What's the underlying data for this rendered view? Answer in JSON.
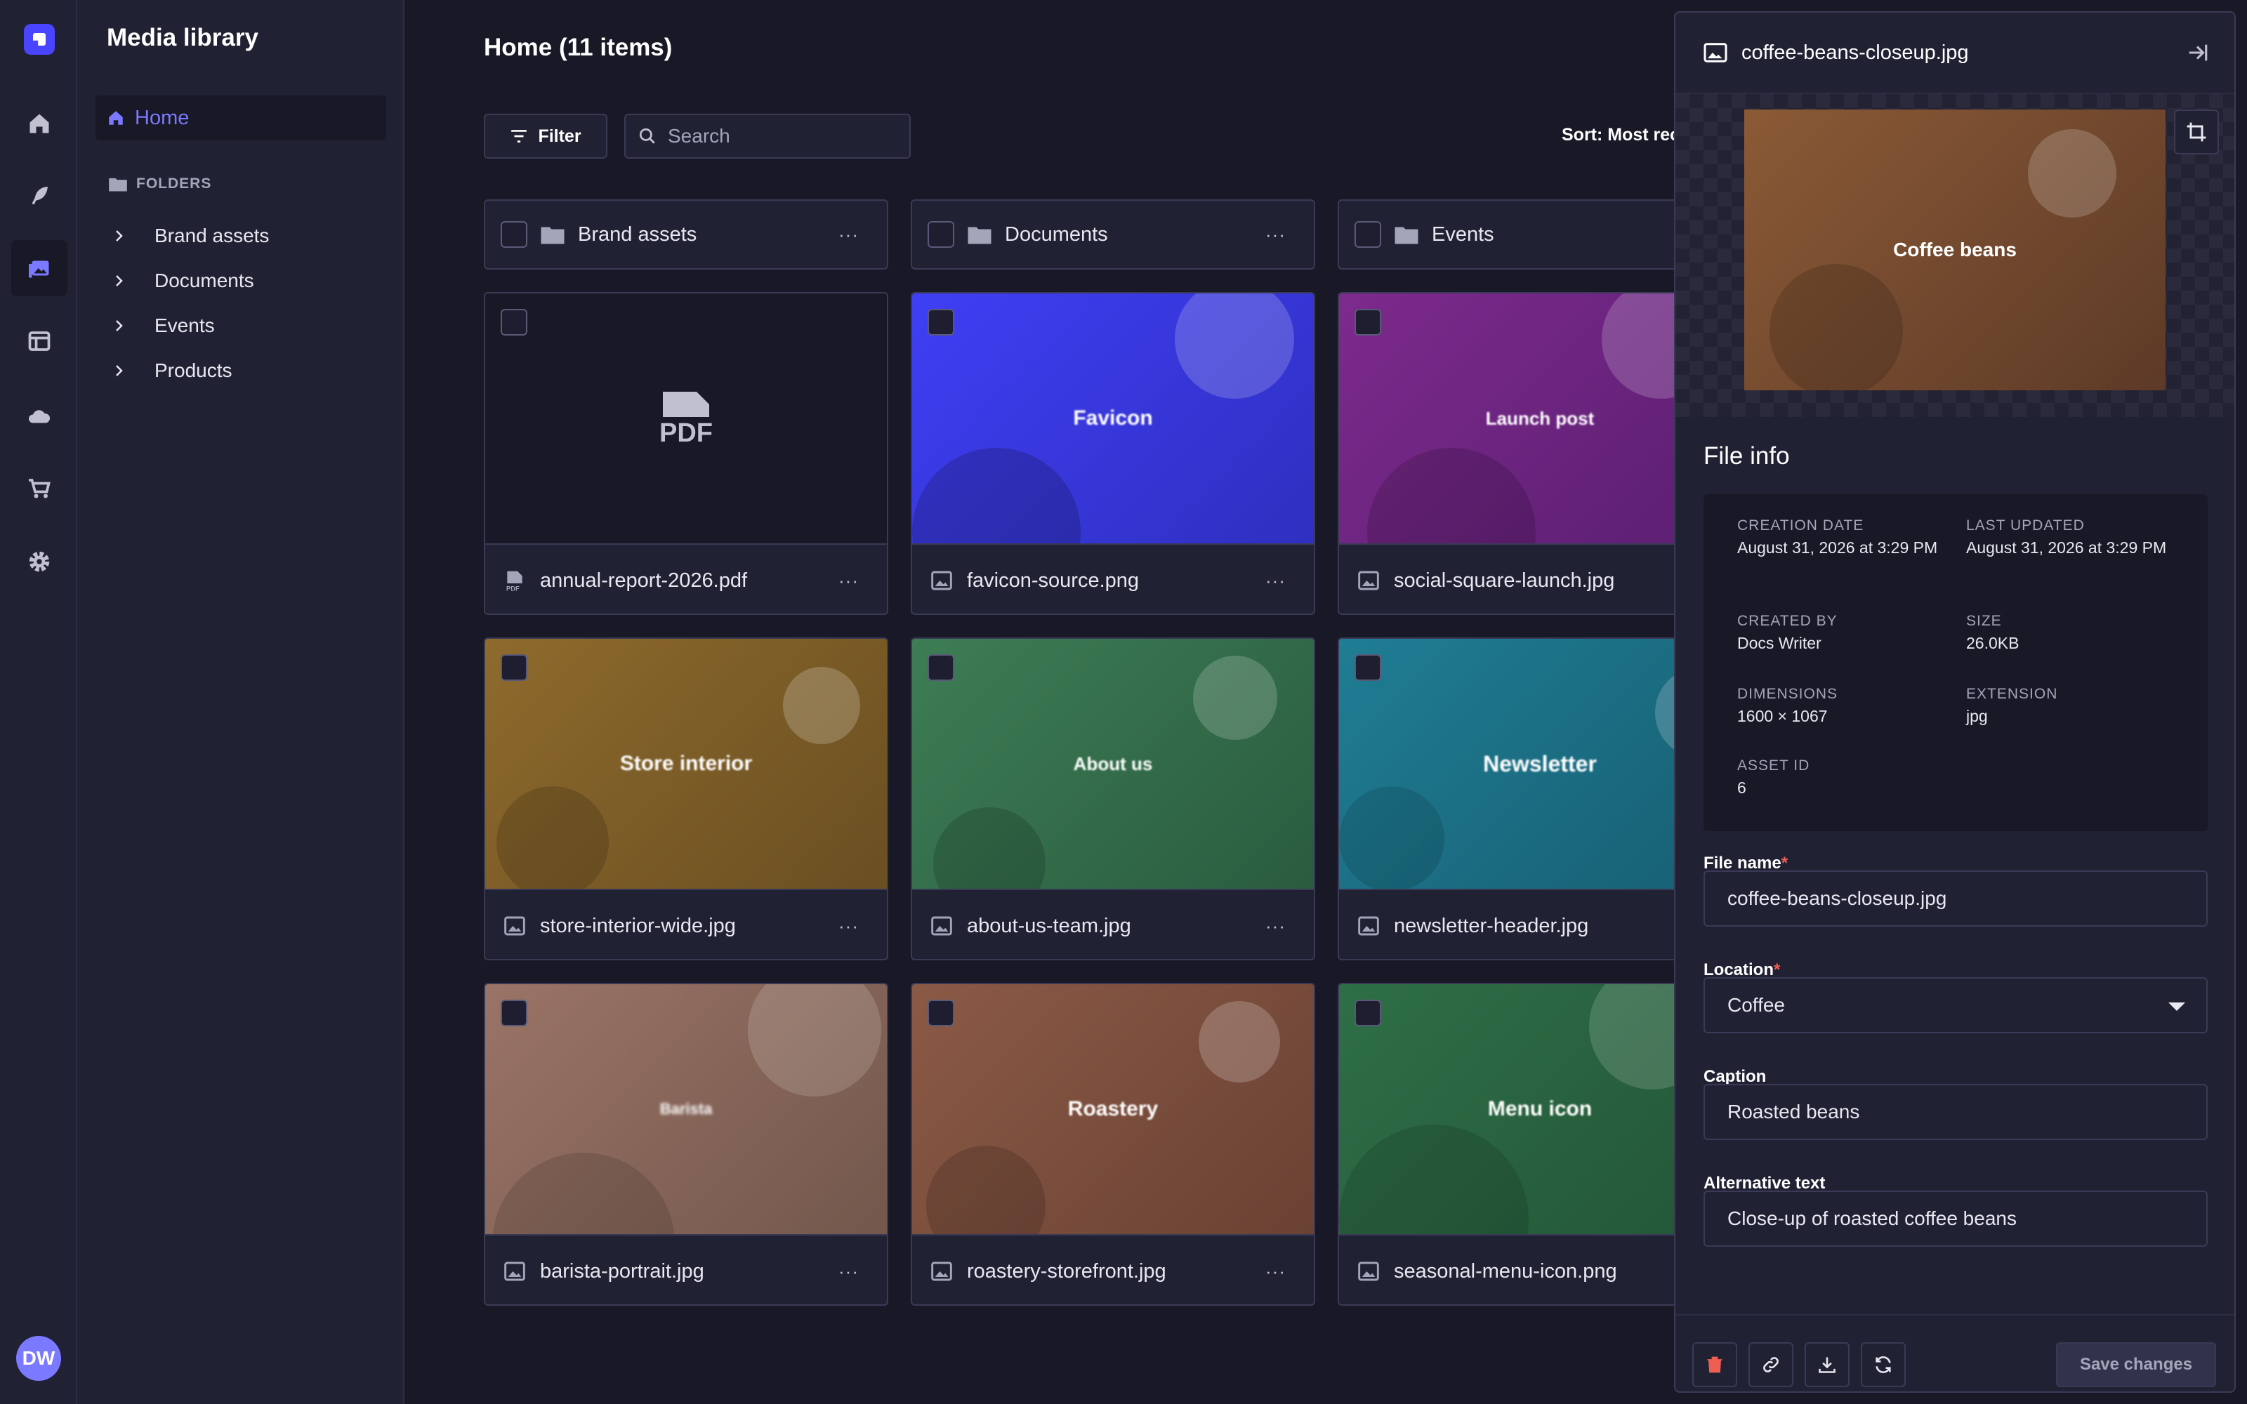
{
  "app": {
    "title": "Media library",
    "user_initials": "DW"
  },
  "rail": {
    "items": [
      "home-icon",
      "feather-icon",
      "media-icon",
      "layout-icon",
      "cloud-icon",
      "cart-icon",
      "gear-icon"
    ],
    "active": "media-icon",
    "accent": "#4945ff"
  },
  "subnav": {
    "home_label": "Home",
    "folders_label": "FOLDERS",
    "folders": [
      "Brand assets",
      "Documents",
      "Events",
      "Products"
    ]
  },
  "main": {
    "title": "Home (11 items)",
    "filter_label": "Filter",
    "search_placeholder": "Search",
    "sort_label": "Sort: Most recent",
    "folder_cards": [
      "Brand assets",
      "Documents",
      "Events"
    ],
    "assets": [
      {
        "name": "annual-report-2026.pdf",
        "type": "pdf",
        "thumb": "PDF"
      },
      {
        "name": "favicon-source.png",
        "type": "image",
        "thumb": "Favicon"
      },
      {
        "name": "social-square-launch.jpg",
        "type": "image",
        "thumb": "Launch post"
      },
      {
        "name": "store-interior-wide.jpg",
        "type": "image",
        "thumb": "Store interior"
      },
      {
        "name": "about-us-team.jpg",
        "type": "image",
        "thumb": "About us"
      },
      {
        "name": "newsletter-header.jpg",
        "type": "image",
        "thumb": "Newsletter"
      },
      {
        "name": "barista-portrait.jpg",
        "type": "image",
        "thumb": "Barista"
      },
      {
        "name": "roastery-storefront.jpg",
        "type": "image",
        "thumb": "Roastery"
      },
      {
        "name": "seasonal-menu-icon.png",
        "type": "image",
        "thumb": "Menu icon"
      }
    ],
    "more_label": "···"
  },
  "panel": {
    "title": "coffee-beans-closeup.jpg",
    "preview_label": "Coffee beans",
    "file_info_title": "File info",
    "info": {
      "creation_date_label": "CREATION DATE",
      "creation_date": "August 31, 2026 at 3:29 PM",
      "last_updated_label": "LAST UPDATED",
      "last_updated": "August 31, 2026 at 3:29 PM",
      "created_by_label": "CREATED BY",
      "created_by": "Docs Writer",
      "size_label": "SIZE",
      "size": "26.0KB",
      "dimensions_label": "DIMENSIONS",
      "dimensions": "1600 × 1067",
      "extension_label": "EXTENSION",
      "extension": "jpg",
      "asset_id_label": "ASSET ID",
      "asset_id": "6"
    },
    "form": {
      "file_name_label": "File name",
      "file_name": "coffee-beans-closeup.jpg",
      "location_label": "Location",
      "location": "Coffee",
      "caption_label": "Caption",
      "caption": "Roasted beans",
      "alt_label": "Alternative text",
      "alt": "Close-up of roasted coffee beans",
      "required_mark": "*"
    },
    "save_label": "Save changes"
  }
}
